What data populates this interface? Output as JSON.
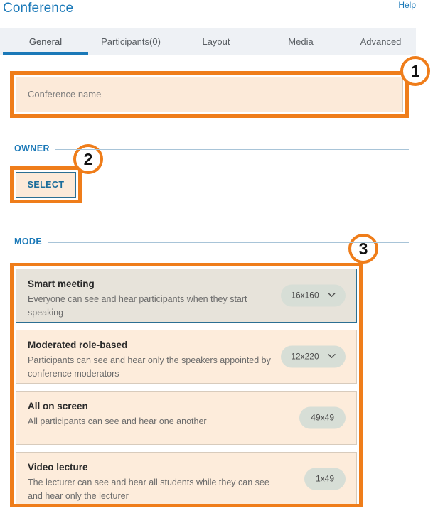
{
  "header": {
    "title": "Conference",
    "help_label": "Help",
    "title_color": "#1b79b8"
  },
  "tabs": [
    {
      "label": "General",
      "active": true
    },
    {
      "label": "Participants(0)",
      "active": false
    },
    {
      "label": "Layout",
      "active": false
    },
    {
      "label": "Media",
      "active": false
    },
    {
      "label": "Advanced",
      "active": false
    }
  ],
  "conference_name": {
    "placeholder": "Conference name",
    "value": ""
  },
  "owner": {
    "section_label": "OWNER",
    "select_label": "SELECT"
  },
  "mode": {
    "section_label": "MODE",
    "cards": [
      {
        "title": "Smart meeting",
        "description": "Everyone can see and hear participants when they start speaking",
        "badge": "16x160",
        "has_chevron": true,
        "selected": true
      },
      {
        "title": "Moderated role-based",
        "description": "Participants can see and hear only the speakers appointed by conference moderators",
        "badge": "12x220",
        "has_chevron": true,
        "selected": false
      },
      {
        "title": "All on screen",
        "description": "All participants can see and hear one another",
        "badge": "49x49",
        "has_chevron": false,
        "selected": false
      },
      {
        "title": "Video lecture",
        "description": "The lecturer can see and hear all students while they can see and hear only the lecturer",
        "badge": "1x49",
        "has_chevron": false,
        "selected": false
      }
    ]
  },
  "callouts": [
    {
      "number": "1",
      "target": "conference-name-field"
    },
    {
      "number": "2",
      "target": "select-button"
    },
    {
      "number": "3",
      "target": "mode-list"
    }
  ],
  "colors": {
    "accent_blue": "#1b79b8",
    "highlight_orange": "#ef7d1a",
    "field_peach": "#fcead9",
    "selected_card": "#e7e3da",
    "badge_pill": "#d7ded6"
  }
}
